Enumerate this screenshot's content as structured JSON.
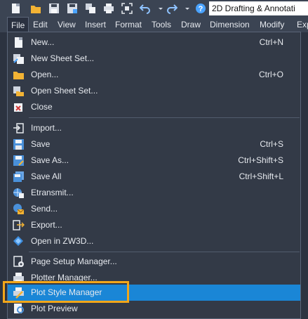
{
  "toolbar": {
    "workspace_value": "2D Drafting & Annotati",
    "icons": [
      "new-icon",
      "open-folder-icon",
      "save-icon",
      "save-as-icon",
      "sheet-set-icon",
      "print-icon",
      "zoom-extents-icon",
      "undo-icon",
      "redo-icon",
      "help-icon"
    ]
  },
  "menubar": {
    "items": [
      "File",
      "Edit",
      "View",
      "Insert",
      "Format",
      "Tools",
      "Draw",
      "Dimension",
      "Modify",
      "Exp"
    ]
  },
  "file_menu": {
    "items": [
      {
        "label": "New...",
        "shortcut": "Ctrl+N",
        "icon": "new-document-icon"
      },
      {
        "label": "New Sheet Set...",
        "shortcut": "",
        "icon": "new-sheet-set-icon"
      },
      {
        "label": "Open...",
        "shortcut": "Ctrl+O",
        "icon": "open-folder-icon"
      },
      {
        "label": "Open Sheet Set...",
        "shortcut": "",
        "icon": "open-sheet-set-icon"
      },
      {
        "label": "Close",
        "shortcut": "",
        "icon": "close-document-icon"
      },
      {
        "label": "Import...",
        "shortcut": "",
        "icon": "import-icon"
      },
      {
        "label": "Save",
        "shortcut": "Ctrl+S",
        "icon": "save-icon"
      },
      {
        "label": "Save As...",
        "shortcut": "Ctrl+Shift+S",
        "icon": "save-as-icon"
      },
      {
        "label": "Save All",
        "shortcut": "Ctrl+Shift+L",
        "icon": "save-all-icon"
      },
      {
        "label": "Etransmit...",
        "shortcut": "",
        "icon": "etransmit-icon"
      },
      {
        "label": "Send...",
        "shortcut": "",
        "icon": "send-mail-icon"
      },
      {
        "label": "Export...",
        "shortcut": "",
        "icon": "export-icon"
      },
      {
        "label": "Open in ZW3D...",
        "shortcut": "",
        "icon": "zw3d-icon"
      },
      {
        "label": "Page Setup Manager...",
        "shortcut": "",
        "icon": "page-setup-icon"
      },
      {
        "label": "Plotter Manager...",
        "shortcut": "",
        "icon": "plotter-manager-icon"
      },
      {
        "label": "Plot Style Manager",
        "shortcut": "",
        "icon": "plot-style-icon",
        "highlighted": true
      },
      {
        "label": "Plot Preview",
        "shortcut": "",
        "icon": "plot-preview-icon"
      }
    ]
  },
  "colors": {
    "highlight": "#1a86d6",
    "callout": "#f2a61a",
    "menu_bg": "#333a47",
    "toolbar_bg": "#3b4453"
  }
}
